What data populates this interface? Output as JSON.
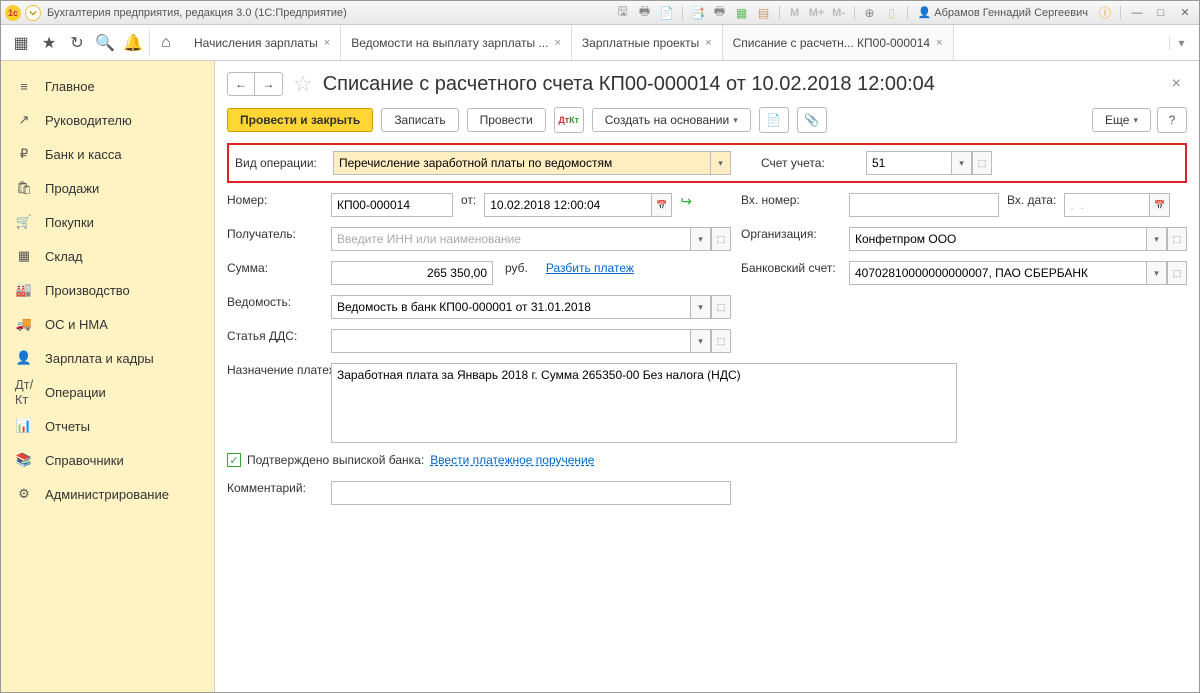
{
  "window_title": "Бухгалтерия предприятия, редакция 3.0  (1С:Предприятие)",
  "user_name": "Абрамов Геннадий Сергеевич",
  "title_icons": {
    "m": "M",
    "mplus": "M+",
    "mminus": "M-"
  },
  "sidebar": {
    "items": [
      {
        "label": "Главное",
        "icon": "≡"
      },
      {
        "label": "Руководителю",
        "icon": "↗"
      },
      {
        "label": "Банк и касса",
        "icon": "₽"
      },
      {
        "label": "Продажи",
        "icon": "🛍"
      },
      {
        "label": "Покупки",
        "icon": "🛒"
      },
      {
        "label": "Склад",
        "icon": "▦"
      },
      {
        "label": "Производство",
        "icon": "🏭"
      },
      {
        "label": "ОС и НМА",
        "icon": "🚚"
      },
      {
        "label": "Зарплата и кадры",
        "icon": "👤"
      },
      {
        "label": "Операции",
        "icon": "Дт/Кт"
      },
      {
        "label": "Отчеты",
        "icon": "📊"
      },
      {
        "label": "Справочники",
        "icon": "📚"
      },
      {
        "label": "Администрирование",
        "icon": "⚙"
      }
    ]
  },
  "tabs": [
    {
      "label": "Начисления зарплаты"
    },
    {
      "label": "Ведомости на выплату зарплаты ..."
    },
    {
      "label": "Зарплатные проекты"
    },
    {
      "label": "Списание с расчетн... КП00-000014",
      "active": true
    }
  ],
  "doc": {
    "title": "Списание с расчетного счета КП00-000014 от 10.02.2018 12:00:04",
    "btn_post_close": "Провести и закрыть",
    "btn_write": "Записать",
    "btn_post": "Провести",
    "btn_create_basis": "Создать на основании",
    "btn_more": "Еще",
    "op_type_label": "Вид операции:",
    "op_type_value": "Перечисление заработной платы по ведомостям",
    "account_label": "Счет учета:",
    "account_value": "51",
    "number_label": "Номер:",
    "number_value": "КП00-000014",
    "from_label": "от:",
    "date_value": "10.02.2018 12:00:04",
    "incoming_no_label": "Вх. номер:",
    "incoming_date_label": "Вх. дата:",
    "incoming_date_value": ".  .",
    "recipient_label": "Получатель:",
    "recipient_placeholder": "Введите ИНН или наименование",
    "org_label": "Организация:",
    "org_value": "Конфетпром ООО",
    "sum_label": "Сумма:",
    "sum_value": "265 350,00",
    "currency": "руб.",
    "split_link": "Разбить платеж",
    "bank_account_label": "Банковский счет:",
    "bank_account_value": "40702810000000000007, ПАО СБЕРБАНК",
    "statement_label": "Ведомость:",
    "statement_value": "Ведомость в банк КП00-000001 от 31.01.2018",
    "dds_label": "Статья ДДС:",
    "purpose_label": "Назначение платежа:",
    "purpose_value": "Заработная плата за Январь 2018 г. Сумма 265350-00 Без налога (НДС)",
    "confirmed_label": "Подтверждено выпиской банка:",
    "enter_payment_link": "Ввести платежное поручение",
    "comment_label": "Комментарий:"
  }
}
